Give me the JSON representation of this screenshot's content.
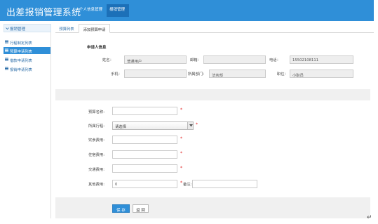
{
  "app": {
    "title": "出差报销管理系统"
  },
  "topnav": {
    "items": [
      "个人信息管理",
      "报销管理"
    ],
    "active_index": 1
  },
  "sidebar": {
    "header": "报销管理",
    "items": [
      {
        "label": "行程制定列表",
        "active": false
      },
      {
        "label": "预算申请列表",
        "active": true
      },
      {
        "label": "借款申请列表",
        "active": false
      },
      {
        "label": "报销申请列表",
        "active": false
      }
    ]
  },
  "tabs": [
    {
      "label": "预算列表",
      "active": false
    },
    {
      "label": "添加预算申请",
      "active": true
    }
  ],
  "applicant": {
    "section_title": "申请人信息",
    "name_label": "姓名：",
    "name_value": "普通用户",
    "email_label": "邮箱：",
    "email_value": "",
    "phone_label": "电话：",
    "phone_value": "15502108111",
    "mobile_label": "手机：",
    "mobile_value": "",
    "dept_label": "所属部门：",
    "dept_value": "法务部",
    "position_label": "职位：",
    "position_value": "小职员"
  },
  "form": {
    "budget_name_label": "预算名称:",
    "budget_name_value": "",
    "trip_label": "所属行程:",
    "trip_selected": "请选择",
    "meal_label": "饮食费用:",
    "meal_value": "",
    "lodging_label": "住宿费用:",
    "lodging_value": "",
    "transport_label": "交通费用:",
    "transport_value": "",
    "other_label": "其他费用:",
    "other_value": "0",
    "remark_label": "备注:",
    "remark_value": "",
    "required_mark": "*"
  },
  "buttons": {
    "save": "保 存",
    "back": "返 回"
  },
  "colors": {
    "primary": "#2f8fd8",
    "nav_active": "#1c70b8",
    "required": "#e02020",
    "band": "#f0f0f0"
  },
  "misc": {
    "return_glyph": "↵"
  }
}
